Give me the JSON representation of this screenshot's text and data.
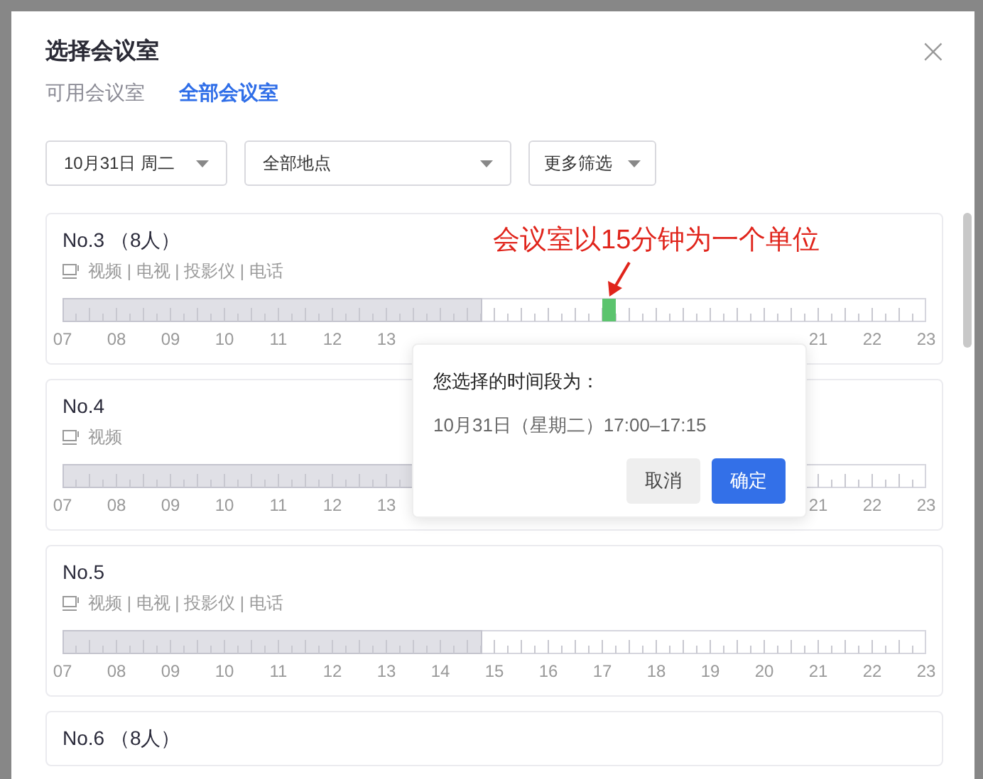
{
  "dialog": {
    "title": "选择会议室",
    "close": "×"
  },
  "tabs": [
    {
      "label": "可用会议室",
      "selected": false
    },
    {
      "label": "全部会议室",
      "selected": true
    }
  ],
  "filters": [
    {
      "value": "10月31日 周二"
    },
    {
      "value": "全部地点"
    },
    {
      "value": "更多筛选"
    }
  ],
  "rooms": [
    {
      "name": "No.3 （8人）",
      "features": "视频 | 电视 | 投影仪 | 电话",
      "level": 0.484,
      "selected": true,
      "hour_labels": [
        "07",
        "08",
        "09",
        "10",
        "11",
        "12",
        "13"
      ],
      "hour_labels_end": [
        "21",
        "22",
        "23"
      ]
    },
    {
      "name": "No.4",
      "features": "视频",
      "level": 0.484,
      "hour_labels": [
        "07",
        "08",
        "09",
        "10",
        "11",
        "12",
        "13"
      ],
      "hour_labels_end": [
        "21",
        "22",
        "23"
      ]
    },
    {
      "name": "No.5",
      "features": "视频 | 电视 | 投影仪 | 电话",
      "level": 0.484,
      "selected": false,
      "hour_labels": [
        "07",
        "08",
        "09",
        "10",
        "11",
        "12",
        "13",
        "14",
        "15",
        "16",
        "17",
        "18",
        "19",
        "20",
        "21",
        "22",
        "23"
      ]
    },
    {
      "name": "No.6 （8人）"
    }
  ],
  "annotation": "会议室以15分钟为一个单位",
  "popover": {
    "title": "您选择的时间段为：",
    "time": "10月31日（星期二）17:00–17:15",
    "buttons": [
      {
        "label": "取消",
        "kind": "secondary"
      },
      {
        "label": "确定",
        "kind": "primary"
      }
    ]
  }
}
